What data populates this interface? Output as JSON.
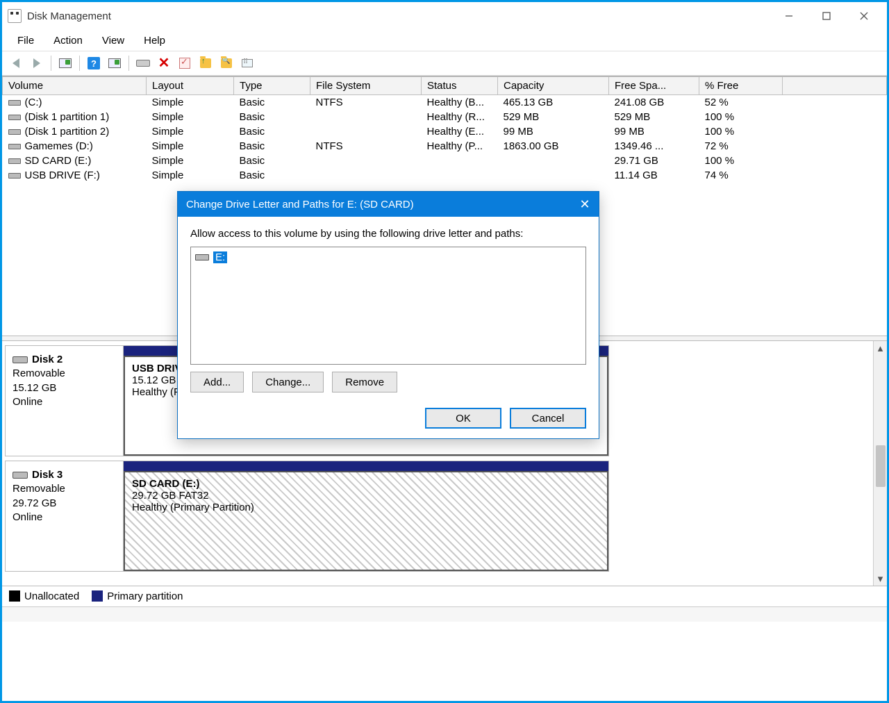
{
  "window": {
    "title": "Disk Management"
  },
  "menu": {
    "file": "File",
    "action": "Action",
    "view": "View",
    "help": "Help"
  },
  "columns": {
    "volume": "Volume",
    "layout": "Layout",
    "type": "Type",
    "fs": "File System",
    "status": "Status",
    "capacity": "Capacity",
    "free": "Free Spa...",
    "pct": "% Free"
  },
  "volumes": [
    {
      "name": "(C:)",
      "layout": "Simple",
      "type": "Basic",
      "fs": "NTFS",
      "status": "Healthy (B...",
      "capacity": "465.13 GB",
      "free": "241.08 GB",
      "pct": "52 %"
    },
    {
      "name": "(Disk 1 partition 1)",
      "layout": "Simple",
      "type": "Basic",
      "fs": "",
      "status": "Healthy (R...",
      "capacity": "529 MB",
      "free": "529 MB",
      "pct": "100 %"
    },
    {
      "name": "(Disk 1 partition 2)",
      "layout": "Simple",
      "type": "Basic",
      "fs": "",
      "status": "Healthy (E...",
      "capacity": "99 MB",
      "free": "99 MB",
      "pct": "100 %"
    },
    {
      "name": "Gamemes (D:)",
      "layout": "Simple",
      "type": "Basic",
      "fs": "NTFS",
      "status": "Healthy (P...",
      "capacity": "1863.00 GB",
      "free": "1349.46 ...",
      "pct": "72 %"
    },
    {
      "name": "SD CARD (E:)",
      "layout": "Simple",
      "type": "Basic",
      "fs": "",
      "status": "",
      "capacity": "",
      "free": "29.71 GB",
      "pct": "100 %"
    },
    {
      "name": "USB DRIVE (F:)",
      "layout": "Simple",
      "type": "Basic",
      "fs": "",
      "status": "",
      "capacity": "",
      "free": "11.14 GB",
      "pct": "74 %"
    }
  ],
  "disks": {
    "d2": {
      "label": "Disk 2",
      "kind": "Removable",
      "size": "15.12 GB",
      "state": "Online",
      "part_title": "USB DRIVE (F:)",
      "part_line1": "15.12 GB FAT32",
      "part_line2": "Healthy (Primary Partition)"
    },
    "d3": {
      "label": "Disk 3",
      "kind": "Removable",
      "size": "29.72 GB",
      "state": "Online",
      "part_title": "SD CARD  (E:)",
      "part_line1": "29.72 GB FAT32",
      "part_line2": "Healthy (Primary Partition)"
    }
  },
  "legend": {
    "unallocated": "Unallocated",
    "primary": "Primary partition"
  },
  "dialog": {
    "title": "Change Drive Letter and Paths for E: (SD CARD)",
    "instruction": "Allow access to this volume by using the following drive letter and paths:",
    "entry": "E:",
    "add": "Add...",
    "change": "Change...",
    "remove": "Remove",
    "ok": "OK",
    "cancel": "Cancel"
  }
}
